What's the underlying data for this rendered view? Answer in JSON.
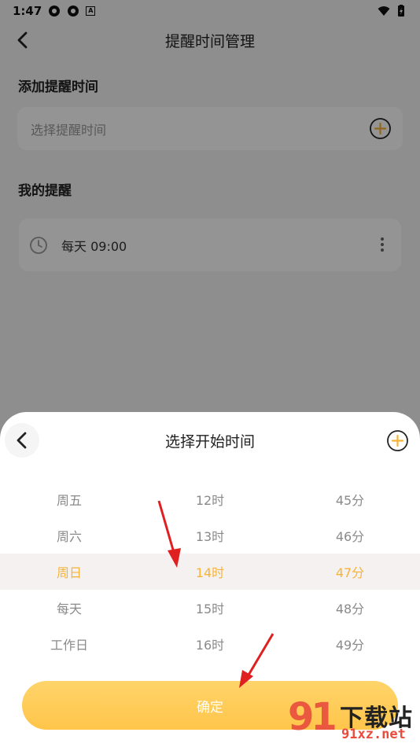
{
  "status_bar": {
    "time": "1:47",
    "badge": "A"
  },
  "page": {
    "title": "提醒时间管理",
    "add_section_title": "添加提醒时间",
    "add_placeholder": "选择提醒时间",
    "my_section_title": "我的提醒",
    "reminders": [
      {
        "label": "每天 09:00"
      }
    ]
  },
  "sheet": {
    "title": "选择开始时间",
    "day_column": [
      "周五",
      "周六",
      "周日",
      "每天",
      "工作日"
    ],
    "hour_column": [
      "12时",
      "13时",
      "14时",
      "15时",
      "16时"
    ],
    "minute_column": [
      "45分",
      "46分",
      "47分",
      "48分",
      "49分"
    ],
    "selected_index": 2,
    "confirm_label": "确定"
  },
  "watermark": {
    "mark": "91",
    "brand": "下载站",
    "url": "91xz.net"
  },
  "colors": {
    "accent": "#f7b338",
    "confirm_button": "#ffc54a",
    "annotation_arrow": "#e02020"
  },
  "icons": [
    "back-icon",
    "add-circle-icon",
    "clock-icon",
    "more-vertical-icon",
    "wifi-icon",
    "battery-icon"
  ]
}
